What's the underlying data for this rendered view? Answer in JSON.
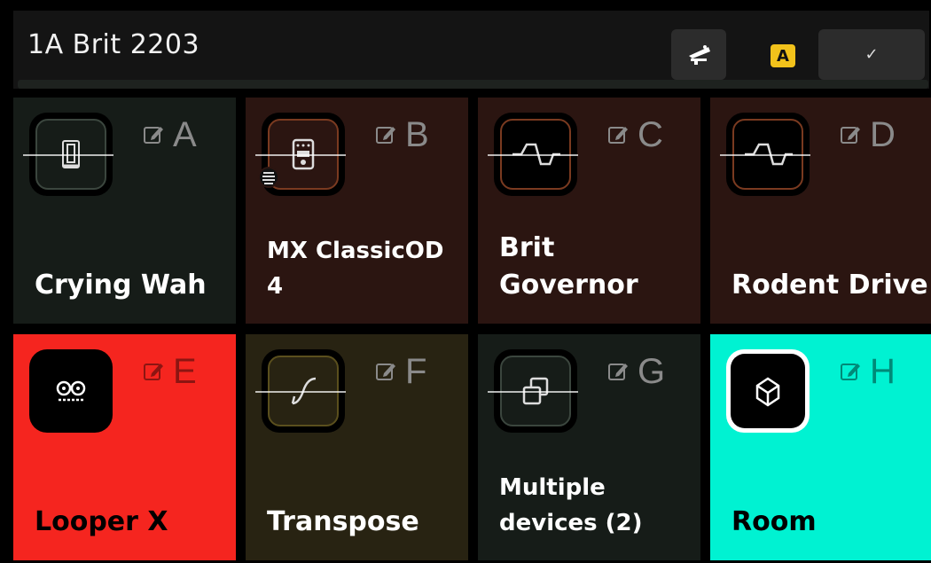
{
  "header": {
    "preset_name": "1A Brit 2203",
    "pedal_icon": "pedal-icon",
    "scene_badge": "A",
    "confirm_label": "✓",
    "colors": {
      "scene_badge": "#f2c21b",
      "background": "#141414"
    }
  },
  "tiles": [
    {
      "letter": "A",
      "name": "Crying Wah",
      "icon": "wah-pedal-icon",
      "bypassed": true,
      "color": "#161c18",
      "ring": "#3b463e"
    },
    {
      "letter": "B",
      "name": "MX ClassicOD 4",
      "icon": "stompbox-icon",
      "bypassed": true,
      "color": "#2b1511",
      "ring": "#7a3a20"
    },
    {
      "letter": "C",
      "name": "Brit Governor",
      "icon": "distortion-wave-icon",
      "bypassed": true,
      "color": "#2b1511",
      "ring": "#7a3a20"
    },
    {
      "letter": "D",
      "name": "Rodent Drive",
      "icon": "distortion-wave-icon",
      "bypassed": true,
      "color": "#2b1511",
      "ring": "#7a3a20"
    },
    {
      "letter": "E",
      "name": "Looper X",
      "icon": "tape-reel-icon",
      "bypassed": false,
      "color": "#f5251f",
      "ring": "#000000"
    },
    {
      "letter": "F",
      "name": "Transpose",
      "icon": "pitch-curve-icon",
      "bypassed": true,
      "color": "#282312",
      "ring": "#5a4f1d"
    },
    {
      "letter": "G",
      "name": "Multiple devices (2)",
      "icon": "stacked-windows-icon",
      "bypassed": true,
      "color": "#161c18",
      "ring": "#3b463e"
    },
    {
      "letter": "H",
      "name": "Room",
      "icon": "room-cube-icon",
      "bypassed": false,
      "color": "#00f2d2",
      "ring": "#ffffff"
    }
  ]
}
